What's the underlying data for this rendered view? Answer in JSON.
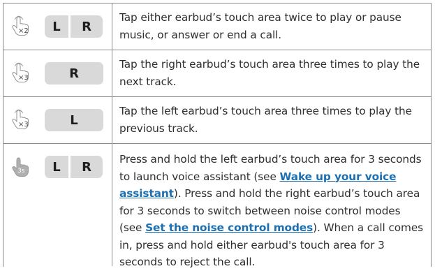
{
  "rows": [
    {
      "gesture": {
        "icon": "hand-tap-outline-icon",
        "count": "×2",
        "keys": [
          "L",
          "R"
        ]
      },
      "description": "Tap either earbud’s touch area twice to play or pause music, or answer or end a call."
    },
    {
      "gesture": {
        "icon": "hand-tap-outline-icon",
        "count": "×3",
        "keys": [
          "R"
        ]
      },
      "description": "Tap the right earbud’s touch area three times to play the next track."
    },
    {
      "gesture": {
        "icon": "hand-tap-outline-icon",
        "count": "×3",
        "keys": [
          "L"
        ]
      },
      "description": "Tap the left earbud’s touch area three times to play the previous track."
    },
    {
      "gesture": {
        "icon": "hand-hold-filled-icon",
        "count": "3s",
        "keys": [
          "L",
          "R"
        ]
      },
      "description_parts": {
        "p1": "Press and hold the left earbud’s touch area for 3 seconds to launch voice assistant (see ",
        "link1": "Wake up your voice assistant",
        "p2": "). Press and hold the right earbud’s touch area for 3 seconds to switch between noise control modes (see ",
        "link2": "Set the noise control modes",
        "p3": "). When a call comes in, press and hold either earbud's touch area for 3 seconds to reject the call."
      }
    }
  ],
  "colors": {
    "key_bg": "#d9d9d9",
    "link": "#1d6fb0",
    "border": "#8a8a8a",
    "hand_filled": "#b0b0b0"
  }
}
